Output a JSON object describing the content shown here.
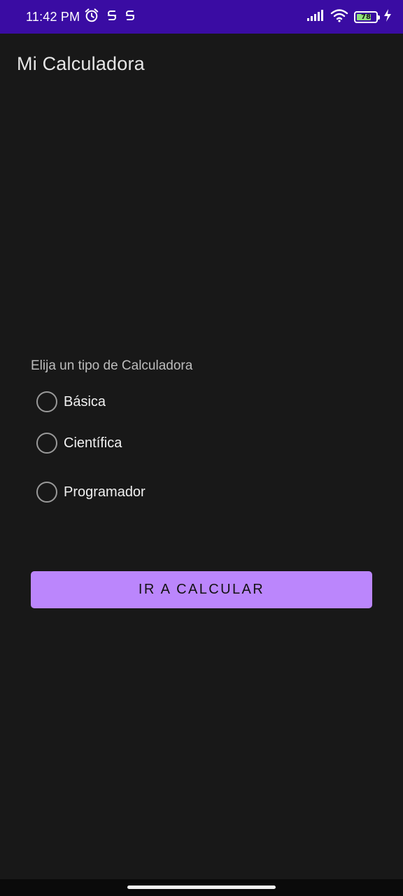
{
  "status_bar": {
    "time": "11:42 PM",
    "battery_level": "78",
    "battery_fraction": 0.78,
    "background_color": "#3a0ca3",
    "left_icons": [
      "alarm-icon",
      "notification-s-icon",
      "notification-s-icon"
    ],
    "right_icons": [
      "signal-icon",
      "wifi-icon",
      "battery-icon",
      "charging-bolt-icon"
    ]
  },
  "app_bar": {
    "title": "Mi Calculadora"
  },
  "form": {
    "prompt": "Elija un tipo de Calculadora",
    "options": [
      {
        "label": "Básica",
        "selected": false
      },
      {
        "label": "Científica",
        "selected": false
      },
      {
        "label": "Programador",
        "selected": false
      }
    ],
    "submit_label": "IR A CALCULAR"
  },
  "colors": {
    "background": "#181818",
    "accent": "#bb86fc",
    "status_bar": "#3a0ca3"
  }
}
